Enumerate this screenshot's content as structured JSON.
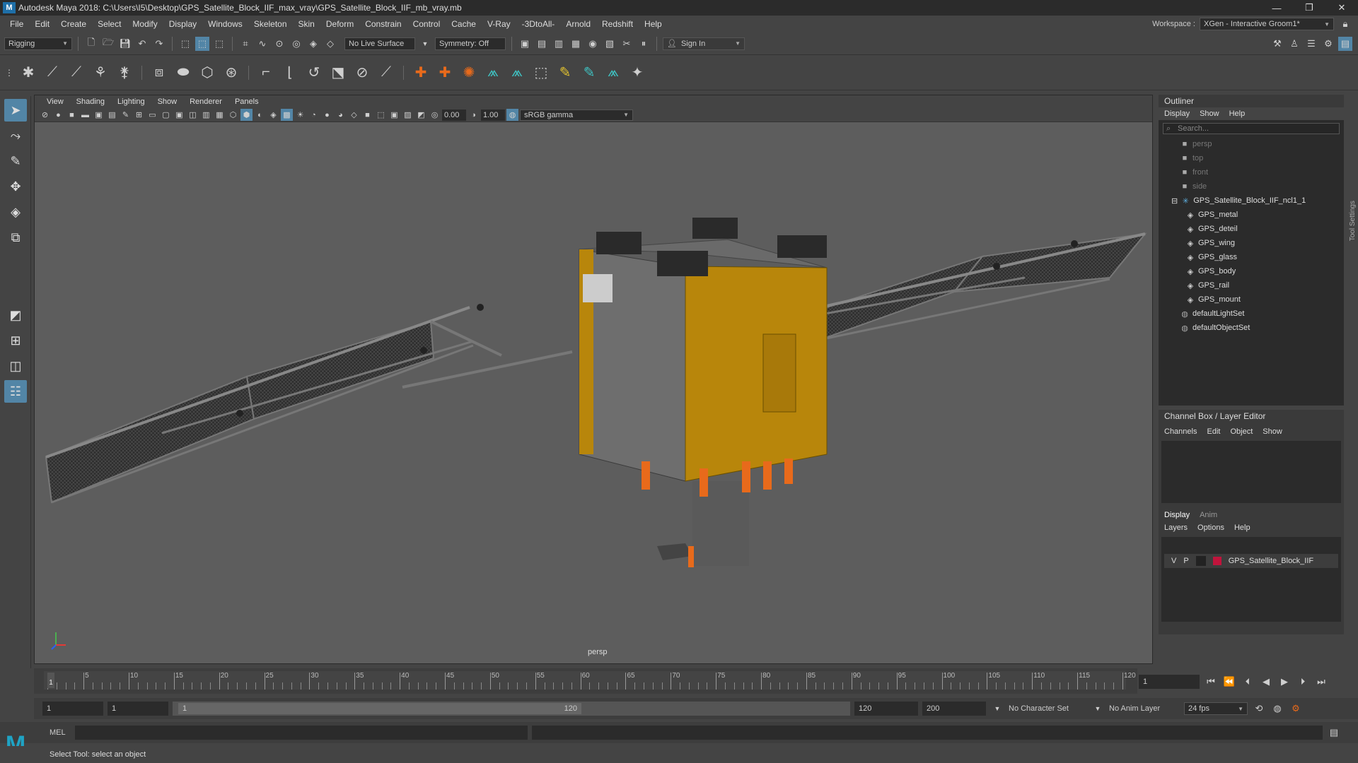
{
  "window": {
    "title": "Autodesk Maya 2018: C:\\Users\\I5\\Desktop\\GPS_Satellite_Block_IIF_max_vray\\GPS_Satellite_Block_IIF_mb_vray.mb",
    "minimize": "—",
    "maximize": "❐",
    "close": "✕"
  },
  "menu": [
    "File",
    "Edit",
    "Create",
    "Select",
    "Modify",
    "Display",
    "Windows",
    "Skeleton",
    "Skin",
    "Deform",
    "Constrain",
    "Control",
    "Cache",
    "V-Ray",
    "-3DtoAll-",
    "Arnold",
    "Redshift",
    "Help"
  ],
  "workspace": {
    "label": "Workspace :",
    "value": "XGen - Interactive Groom1*"
  },
  "status": {
    "mode": "Rigging",
    "live_surface": "No Live Surface",
    "symmetry": "Symmetry: Off",
    "sign_in": "Sign In"
  },
  "viewport": {
    "menu": [
      "View",
      "Shading",
      "Lighting",
      "Show",
      "Renderer",
      "Panels"
    ],
    "exposure": "0.00",
    "gamma": "1.00",
    "colorspace": "sRGB gamma",
    "camera": "persp"
  },
  "outliner": {
    "title": "Outliner",
    "menu": [
      "Display",
      "Show",
      "Help"
    ],
    "search_placeholder": "Search...",
    "items": [
      {
        "label": "persp",
        "kind": "camera",
        "dim": true,
        "indent": 0
      },
      {
        "label": "top",
        "kind": "camera",
        "dim": true,
        "indent": 0
      },
      {
        "label": "front",
        "kind": "camera",
        "dim": true,
        "indent": 0
      },
      {
        "label": "side",
        "kind": "camera",
        "dim": true,
        "indent": 0
      },
      {
        "label": "GPS_Satellite_Block_IIF_ncl1_1",
        "kind": "group",
        "dim": false,
        "indent": 0
      },
      {
        "label": "GPS_metal",
        "kind": "mesh",
        "dim": false,
        "indent": 1
      },
      {
        "label": "GPS_deteil",
        "kind": "mesh",
        "dim": false,
        "indent": 1
      },
      {
        "label": "GPS_wing",
        "kind": "mesh",
        "dim": false,
        "indent": 1
      },
      {
        "label": "GPS_glass",
        "kind": "mesh",
        "dim": false,
        "indent": 1
      },
      {
        "label": "GPS_body",
        "kind": "mesh",
        "dim": false,
        "indent": 1
      },
      {
        "label": "GPS_rail",
        "kind": "mesh",
        "dim": false,
        "indent": 1
      },
      {
        "label": "GPS_mount",
        "kind": "mesh",
        "dim": false,
        "indent": 1
      },
      {
        "label": "defaultLightSet",
        "kind": "set",
        "dim": false,
        "indent": 0
      },
      {
        "label": "defaultObjectSet",
        "kind": "set",
        "dim": false,
        "indent": 0
      }
    ]
  },
  "channelbox": {
    "title": "Channel Box / Layer Editor",
    "menu": [
      "Channels",
      "Edit",
      "Object",
      "Show"
    ]
  },
  "layers": {
    "tabs": [
      "Display",
      "Anim"
    ],
    "menu": [
      "Layers",
      "Options",
      "Help"
    ],
    "row": {
      "v": "V",
      "p": "P",
      "name": "GPS_Satellite_Block_IIF",
      "color": "#c0143c"
    }
  },
  "timeline": {
    "labels": [
      "5",
      "10",
      "15",
      "20",
      "25",
      "30",
      "35",
      "40",
      "45",
      "50",
      "55",
      "60",
      "65",
      "70",
      "75",
      "80",
      "85",
      "90",
      "95",
      "100",
      "105",
      "110",
      "115",
      "120"
    ],
    "current_marker": "1",
    "current_frame": "1"
  },
  "range": {
    "start": "1",
    "anim_start": "1",
    "slider_start": "1",
    "slider_end": "120",
    "end": "120",
    "anim_end": "200",
    "character_set": "No Character Set",
    "anim_layer": "No Anim Layer",
    "fps": "24 fps"
  },
  "cmd": {
    "lang": "MEL"
  },
  "help": "Select Tool: select an object",
  "side_tab": "Tool Settings",
  "colors": {
    "body": "#b8860b",
    "panel": "#444444",
    "accent": "#5285a6"
  }
}
